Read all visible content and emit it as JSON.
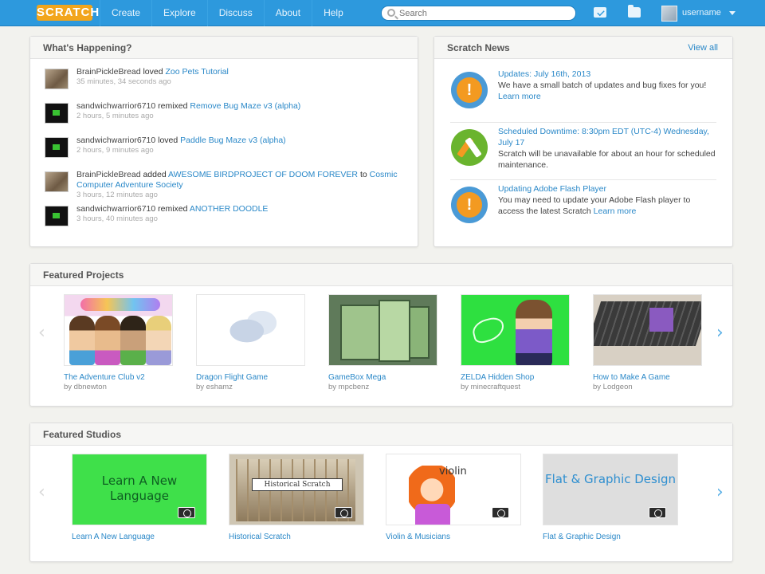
{
  "nav": {
    "logo": "SCRATCH",
    "links": [
      "Create",
      "Explore",
      "Discuss",
      "About",
      "Help"
    ],
    "search_placeholder": "Search",
    "username": "username"
  },
  "happening": {
    "title": "What's Happening?",
    "items": [
      {
        "actor": "BrainPickleBread",
        "verb": " loved ",
        "target": "Zoo Pets Tutorial",
        "time": "35 minutes, 34 seconds ago"
      },
      {
        "actor": "sandwichwarrior6710",
        "verb": " remixed ",
        "target": "Remove Bug Maze v3 (alpha)",
        "time": "2 hours, 5 minutes ago"
      },
      {
        "actor": "sandwichwarrior6710",
        "verb": " loved ",
        "target": "Paddle Bug Maze v3 (alpha)",
        "time": "2 hours, 9 minutes ago"
      },
      {
        "actor": "BrainPickleBread",
        "verb": " added ",
        "target": "AWESOME BIRDPROJECT OF DOOM FOREVER",
        "extra": " to ",
        "target2": "Cosmic Computer Adventure Society",
        "time": "3 hours, 12 minutes ago"
      },
      {
        "actor": "sandwichwarrior6710",
        "verb": " remixed ",
        "target": "ANOTHER DOODLE",
        "time": "3 hours, 40 minutes ago"
      }
    ]
  },
  "news": {
    "title": "Scratch News",
    "view_all": "View all",
    "items": [
      {
        "title": "Updates: July 16th, 2013",
        "body": "We have a small batch of updates and bug fixes for you!",
        "link": "Learn more"
      },
      {
        "title": "Scheduled Downtime: 8:30pm EDT (UTC-4) Wednesday, July 17",
        "body": "Scratch will be unavailable for about an hour for scheduled maintenance.",
        "link": ""
      },
      {
        "title": "Updating Adobe Flash Player",
        "body": "You may need to update your Adobe Flash player to access the latest Scratch",
        "link": "Learn more"
      }
    ]
  },
  "featured_projects": {
    "title": "Featured Projects",
    "items": [
      {
        "title": "The Adventure Club v2",
        "by": "by dbnewton"
      },
      {
        "title": "Dragon Flight Game",
        "by": "by eshamz"
      },
      {
        "title": "GameBox Mega",
        "by": "by mpcbenz"
      },
      {
        "title": "ZELDA Hidden Shop",
        "by": "by minecraftquest"
      },
      {
        "title": "How to Make A Game",
        "by": "by Lodgeon"
      }
    ]
  },
  "featured_studios": {
    "title": "Featured Studios",
    "items": [
      {
        "title": "Learn A New Language",
        "overlay": "Learn A New Language"
      },
      {
        "title": "Historical Scratch",
        "overlay": "Historical Scratch"
      },
      {
        "title": "Violin & Musicians",
        "overlay": "violin"
      },
      {
        "title": "Flat & Graphic Design",
        "overlay": "Flat & Graphic Design"
      }
    ]
  },
  "colors": {
    "nav_blue": "#2d99dd",
    "link_blue": "#2a88c8",
    "accent_orange": "#f39a21"
  }
}
